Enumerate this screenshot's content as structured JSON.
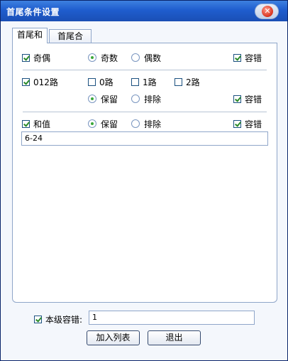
{
  "window": {
    "title": "首尾条件设置"
  },
  "tabs": [
    "首尾和",
    "首尾合"
  ],
  "parity": {
    "label": "奇偶",
    "odd": "奇数",
    "even": "偶数",
    "tolerance": "容错"
  },
  "route012": {
    "label": "012路",
    "r0": "0路",
    "r1": "1路",
    "r2": "2路",
    "keep": "保留",
    "exclude": "排除",
    "tolerance": "容错"
  },
  "sum": {
    "label": "和值",
    "keep": "保留",
    "exclude": "排除",
    "tolerance": "容错",
    "value": "6-24"
  },
  "footer": {
    "level_tolerance_label": "本级容错:",
    "level_tolerance_value": "1",
    "add_button": "加入列表",
    "exit_button": "退出"
  }
}
